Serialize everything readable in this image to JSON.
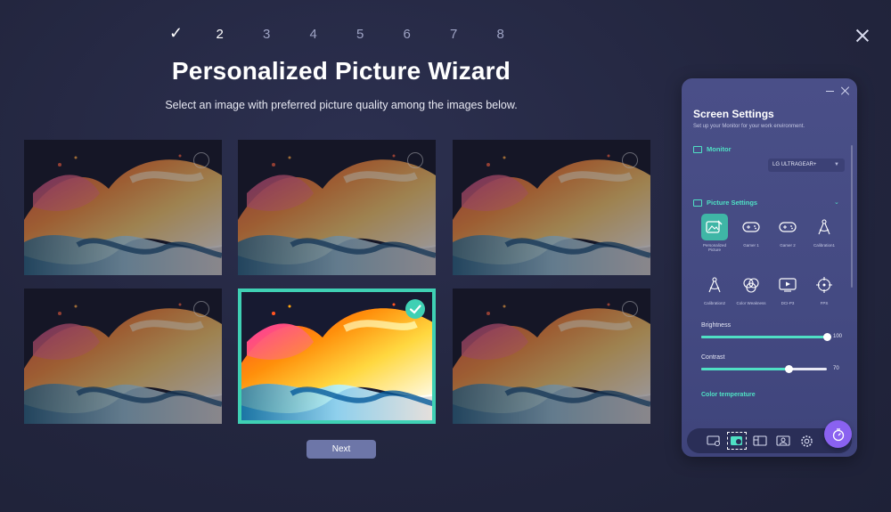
{
  "wizard": {
    "steps": [
      "✓",
      "2",
      "3",
      "4",
      "5",
      "6",
      "7",
      "8"
    ],
    "title": "Personalized Picture Wizard",
    "subtitle": "Select an image with preferred picture quality among the images below.",
    "next_label": "Next",
    "selected_image_index": 4
  },
  "panel": {
    "title": "Screen Settings",
    "subtitle": "Set up your Monitor for your work environment.",
    "monitor_section": "Monitor",
    "monitor_value": "LG ULTRAGEAR+",
    "picture_section": "Picture Settings",
    "modes": [
      {
        "label": "Personalized Picture",
        "icon": "personalized-picture-icon"
      },
      {
        "label": "Gamer 1",
        "icon": "gamepad-icon"
      },
      {
        "label": "Gamer 2",
        "icon": "gamepad-icon"
      },
      {
        "label": "Calibration1",
        "icon": "compass-icon"
      },
      {
        "label": "Calibration2",
        "icon": "compass-icon"
      },
      {
        "label": "Color Weakness",
        "icon": "color-circles-icon"
      },
      {
        "label": "DCI-P3",
        "icon": "play-screen-icon"
      },
      {
        "label": "FPS",
        "icon": "crosshair-icon"
      }
    ],
    "brightness_label": "Brightness",
    "brightness_value": "100",
    "brightness_level": 1.0,
    "contrast_label": "Contrast",
    "contrast_value": "70",
    "contrast_level": 0.7,
    "color_temperature_label": "Color temperature"
  },
  "colors": {
    "accent": "#4fe0c4",
    "selection": "#3fd0b4",
    "fab": "#8a62f0"
  }
}
